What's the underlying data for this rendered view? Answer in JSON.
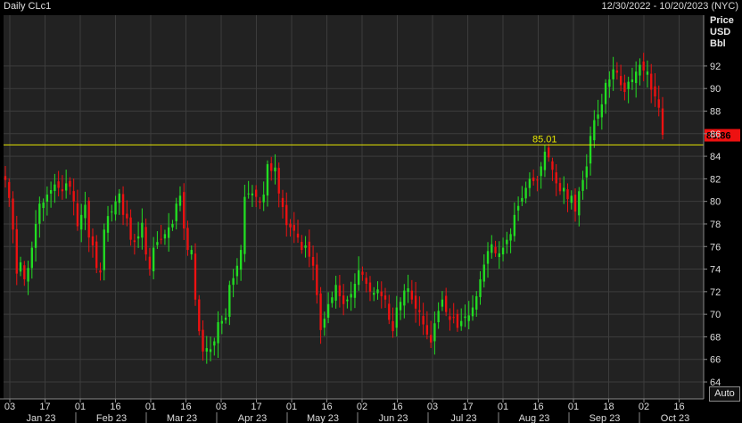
{
  "header": {
    "title": "Daily CLc1",
    "date_range": "12/30/2022 - 10/20/2023 (NYC)"
  },
  "axis": {
    "y_unit_lines": [
      "Price",
      "USD",
      "Bbl"
    ],
    "auto_button": "Auto"
  },
  "colors": {
    "background": "#222222",
    "grid": "#3c3c3c",
    "up": "#22dd22",
    "down": "#ee1111",
    "hline": "#e6e600",
    "last_price_tag": "#ee1111"
  },
  "chart_data": {
    "type": "candlestick",
    "ylim": [
      62.5,
      96.5
    ],
    "y_ticks": [
      64,
      66,
      68,
      70,
      72,
      74,
      76,
      78,
      80,
      82,
      84,
      86,
      88,
      90,
      92
    ],
    "x_tick_labels": [
      "03",
      "17",
      "01",
      "16",
      "01",
      "16",
      "03",
      "17",
      "01",
      "16",
      "02",
      "16",
      "03",
      "17",
      "01",
      "16",
      "01",
      "18",
      "02",
      "16"
    ],
    "x_month_labels": [
      "Jan 23",
      "Feb 23",
      "Mar 23",
      "Apr 23",
      "May 23",
      "Jun 23",
      "Jul 23",
      "Aug 23",
      "Sep 23",
      "Oct 23"
    ],
    "horizontal_line": {
      "value": 85.01,
      "label": "85.01"
    },
    "last_price": {
      "value": 85.86,
      "label": "85.86"
    },
    "series_close": [
      81.9,
      80.3,
      77.5,
      73.6,
      74.6,
      73.1,
      74.1,
      75.9,
      78.0,
      79.8,
      79.9,
      80.6,
      81.0,
      81.5,
      81.2,
      80.9,
      81.6,
      81.3,
      80.0,
      77.8,
      78.8,
      79.7,
      76.8,
      76.1,
      74.1,
      73.7,
      77.5,
      78.7,
      79.1,
      80.0,
      80.7,
      78.8,
      78.5,
      76.6,
      76.4,
      76.9,
      78.1,
      75.3,
      74.0,
      75.9,
      76.4,
      76.6,
      77.1,
      77.7,
      78.0,
      79.8,
      80.5,
      77.6,
      75.7,
      75.7,
      71.3,
      68.5,
      66.7,
      67.0,
      66.9,
      67.6,
      69.3,
      69.4,
      69.7,
      72.6,
      73.2,
      74.3,
      75.7,
      80.4,
      80.7,
      80.7,
      80.4,
      79.9,
      80.6,
      83.3,
      82.7,
      83.0,
      80.7,
      79.5,
      77.9,
      77.7,
      77.4,
      76.8,
      75.7,
      76.1,
      75.1,
      74.3,
      71.7,
      68.6,
      69.6,
      70.9,
      71.5,
      72.6,
      71.6,
      70.9,
      71.3,
      71.8,
      72.7,
      73.9,
      73.5,
      72.7,
      72.0,
      71.9,
      72.2,
      71.6,
      71.3,
      69.5,
      68.5,
      70.6,
      71.1,
      72.1,
      72.3,
      71.3,
      70.5,
      70.2,
      69.1,
      68.2,
      67.5,
      69.2,
      70.3,
      71.3,
      70.2,
      69.5,
      69.7,
      68.8,
      69.4,
      69.8,
      69.9,
      70.6,
      71.6,
      73.1,
      74.4,
      75.6,
      76.2,
      75.4,
      75.4,
      75.9,
      76.6,
      77.1,
      78.8,
      79.6,
      80.3,
      81.2,
      82.0,
      81.8,
      81.9,
      83.1,
      84.4,
      83.9,
      82.8,
      81.6,
      80.9,
      81.2,
      80.2,
      80.5,
      79.1,
      80.9,
      81.9,
      83.1,
      85.8,
      87.2,
      87.7,
      88.6,
      90.5,
      90.8,
      91.7,
      91.4,
      90.3,
      89.7,
      90.6,
      90.8,
      91.5,
      92.1,
      91.6,
      91.5,
      89.9,
      89.3,
      88.3,
      85.9
    ]
  }
}
